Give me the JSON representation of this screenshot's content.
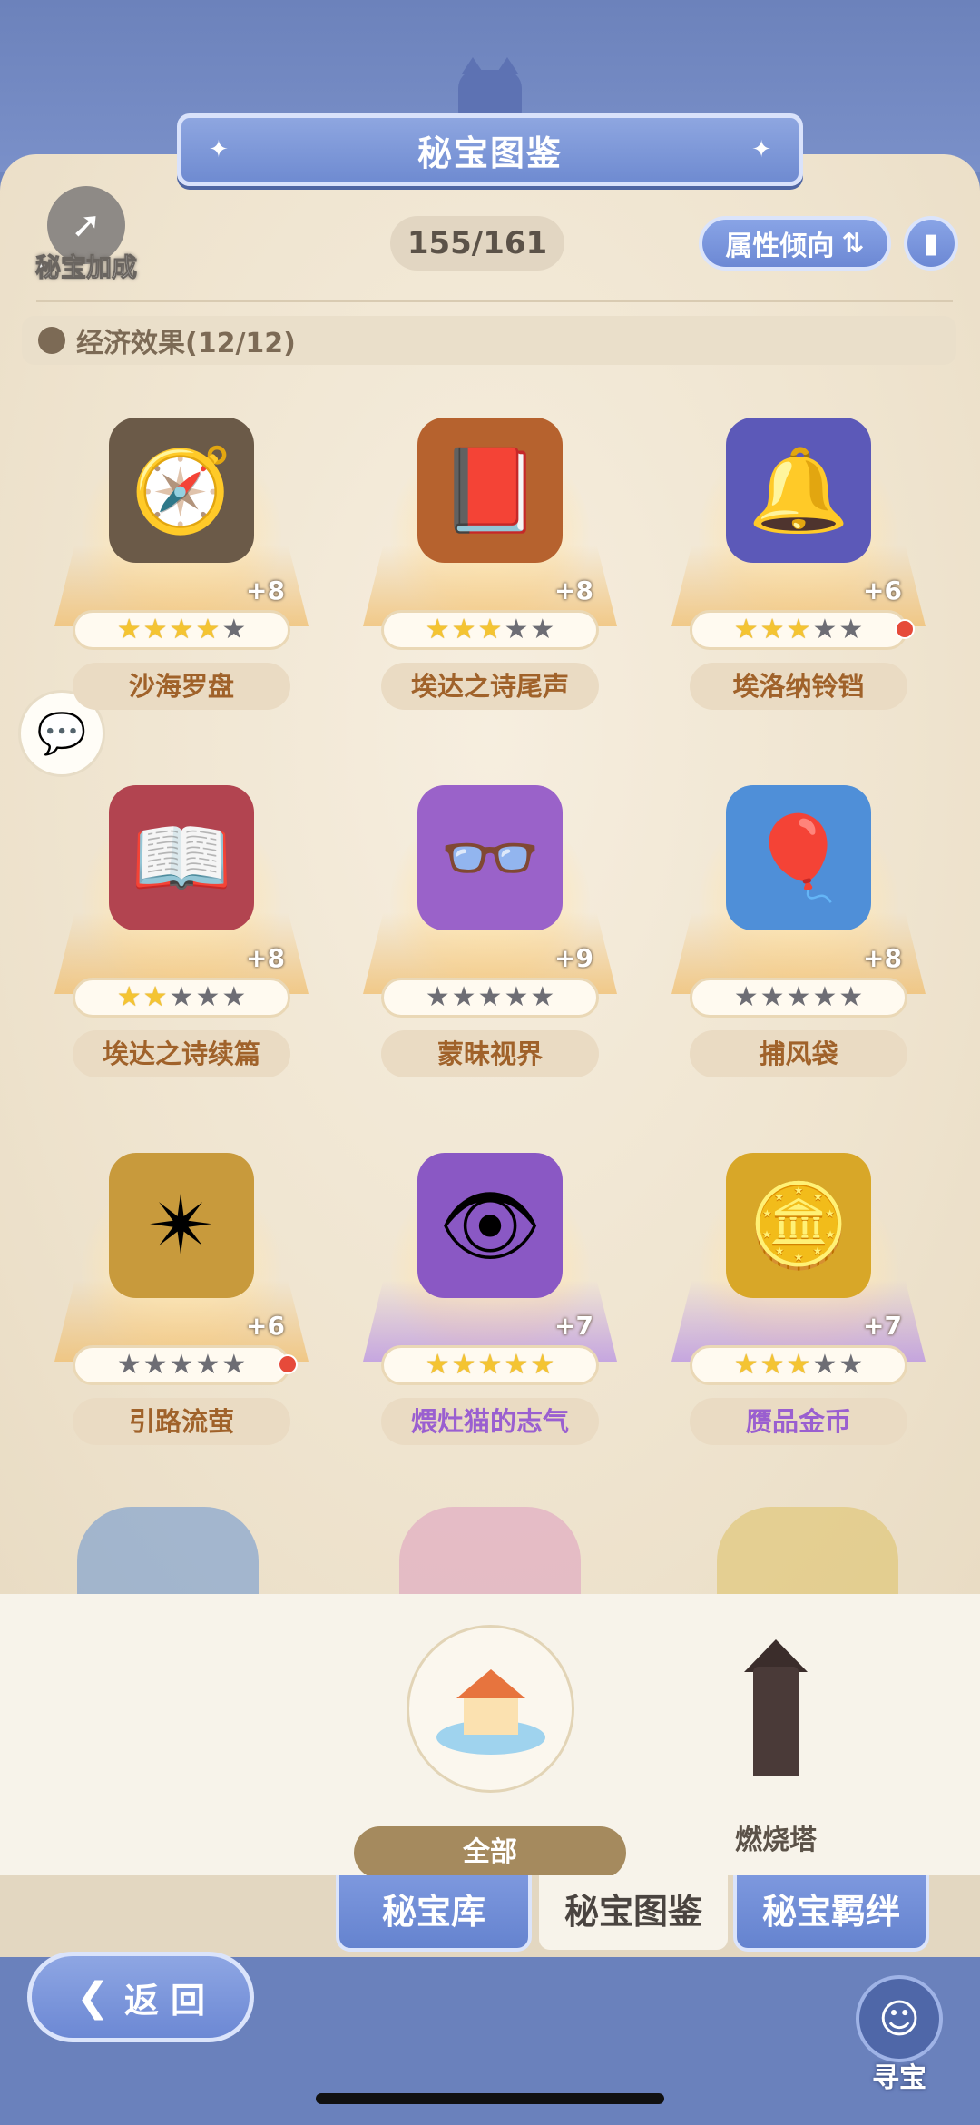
{
  "header": {
    "title": "秘宝图鉴",
    "bonus_label": "秘宝加成",
    "counter": "155/161",
    "attr_button": "属性倾向",
    "attr_icon": "swap-vertical-icon",
    "info_icon": "book-icon"
  },
  "section": {
    "label": "经济效果(12/12)"
  },
  "items": [
    {
      "name": "沙海罗盘",
      "plus": "+8",
      "stars": 4,
      "icon": "🧭",
      "bg": "#6b5a48",
      "red_dot": false,
      "rarity": "gold"
    },
    {
      "name": "埃达之诗尾声",
      "plus": "+8",
      "stars": 3,
      "icon": "📕",
      "bg": "#b6622e",
      "red_dot": false,
      "rarity": "gold"
    },
    {
      "name": "埃洛纳铃铛",
      "plus": "+6",
      "stars": 3,
      "icon": "🔔",
      "bg": "#5c59b8",
      "red_dot": true,
      "rarity": "gold"
    },
    {
      "name": "埃达之诗续篇",
      "plus": "+8",
      "stars": 2,
      "icon": "📖",
      "bg": "#b24450",
      "red_dot": false,
      "rarity": "gold"
    },
    {
      "name": "蒙昧视界",
      "plus": "+9",
      "stars": 0,
      "icon": "👓",
      "bg": "#9a62c9",
      "red_dot": false,
      "rarity": "gold"
    },
    {
      "name": "捕风袋",
      "plus": "+8",
      "stars": 0,
      "icon": "🎈",
      "bg": "#4f8fd8",
      "red_dot": false,
      "rarity": "gold"
    },
    {
      "name": "引路流萤",
      "plus": "+6",
      "stars": 0,
      "icon": "✴",
      "bg": "#c89a3c",
      "red_dot": true,
      "rarity": "gold"
    },
    {
      "name": "煨灶猫的志气",
      "plus": "+7",
      "stars": 5,
      "icon": "👁",
      "bg": "#8a58c4",
      "red_dot": false,
      "rarity": "purple"
    },
    {
      "name": "赝品金币",
      "plus": "+7",
      "stars": 3,
      "icon": "🪙",
      "bg": "#d8a728",
      "red_dot": false,
      "rarity": "purple"
    }
  ],
  "filters": {
    "all": "全部",
    "tower": "燃烧塔"
  },
  "tabs": {
    "library": "秘宝库",
    "codex": "秘宝图鉴",
    "bond": "秘宝羁绊"
  },
  "bottom": {
    "back": "返 回",
    "treasure": "寻宝"
  }
}
